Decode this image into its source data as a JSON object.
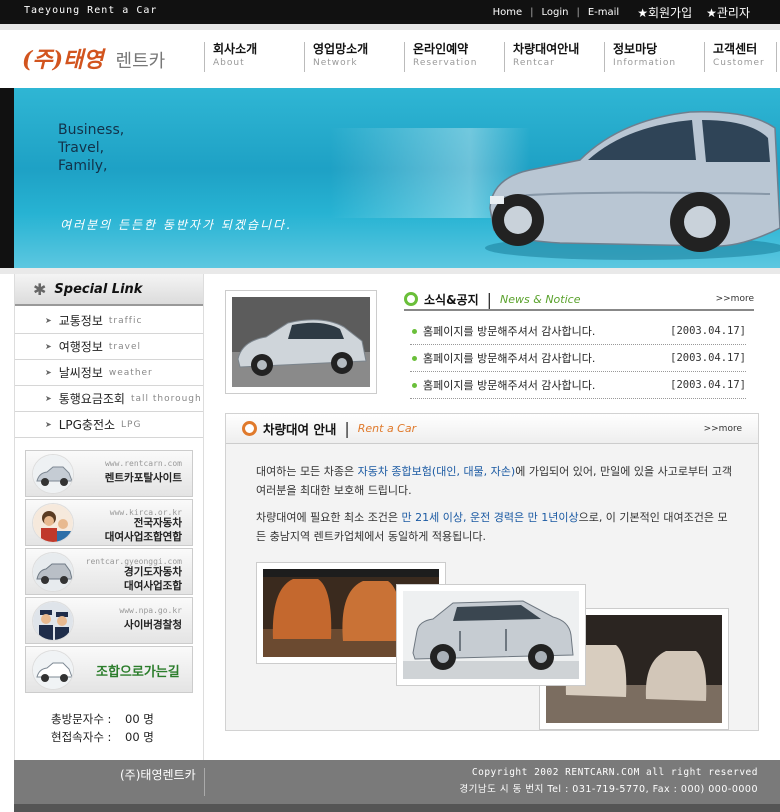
{
  "topbar": {
    "brand": "Taeyoung Rent a Car",
    "links": [
      "Home",
      "Login",
      "E-mail"
    ],
    "join": "★회원가입",
    "admin": "★관리자"
  },
  "logo": {
    "name": "(주)태영",
    "suffix": "렌트카"
  },
  "nav": [
    {
      "ko": "회사소개",
      "en": "About"
    },
    {
      "ko": "영업망소개",
      "en": "Network"
    },
    {
      "ko": "온라인예약",
      "en": "Reservation"
    },
    {
      "ko": "차량대여안내",
      "en": "Rentcar"
    },
    {
      "ko": "정보마당",
      "en": "Information"
    },
    {
      "ko": "고객센터",
      "en": "Customer"
    }
  ],
  "banner": {
    "tagline": [
      "Business,",
      "Travel,",
      "Family,"
    ],
    "slogan": "여러분의 든든한 동반자가 되겠습니다."
  },
  "special_link": {
    "title": "Special Link",
    "items": [
      {
        "ko": "교통정보",
        "en": "traffic"
      },
      {
        "ko": "여행정보",
        "en": "travel"
      },
      {
        "ko": "날씨정보",
        "en": "weather"
      },
      {
        "ko": "통행요금조회",
        "en": "tall thorough"
      },
      {
        "ko": "LPG충전소",
        "en": "LPG"
      }
    ]
  },
  "link_banners": [
    {
      "url": "www.rentcarn.com",
      "name": "렌트카포탈사이트"
    },
    {
      "url": "www.kirca.or.kr",
      "name": "전국자동차\n대여사업조합연합"
    },
    {
      "url": "rentcar.gyeonggi.com",
      "name": "경기도자동차\n대여사업조합"
    },
    {
      "url": "www.npa.go.kr",
      "name": "사이버경찰청"
    },
    {
      "name": "조합으로가는길"
    }
  ],
  "stats": {
    "total_label": "총방문자수 :",
    "total_value": "00 명",
    "current_label": "현접속자수 :",
    "current_value": "00 명"
  },
  "news": {
    "title": "소식&공지",
    "subtitle": "News & Notice",
    "more": ">>more",
    "items": [
      {
        "title": "홈페이지를 방문해주셔서 감사합니다.",
        "date": "[2003.04.17]"
      },
      {
        "title": "홈페이지를 방문해주셔서 감사합니다.",
        "date": "[2003.04.17]"
      },
      {
        "title": "홈페이지를 방문해주셔서 감사합니다.",
        "date": "[2003.04.17]"
      }
    ]
  },
  "rent": {
    "title": "차량대여 안내",
    "subtitle": "Rent a Car",
    "more": ">>more",
    "p1_a": "대여하는 모든 차종은 ",
    "p1_hl": "자동차 종합보험(대인, 대물, 자손)",
    "p1_b": "에 가입되어 있어, 만일에 있을 사고로부터 고객여러분을 최대한 보호해 드립니다.",
    "p2_a": "차량대여에 필요한 최소 조건은 ",
    "p2_hl": "만 21세 이상, 운전 경력은 만 1년이상",
    "p2_b": "으로, 이 기본적인 대여조건은 모든 충남지역 렌트카업체에서 동일하게 적용됩니다."
  },
  "footer": {
    "company": "(주)태영렌트카",
    "copyright": "Copyright 2002 RENTCARN.COM all right reserved",
    "address": "경기남도  시  동  번지   Tel : 031-719-5770, Fax : 000) 000-0000"
  },
  "colors": {
    "accent_orange": "#d2541e",
    "news_green": "#6abf3a",
    "rent_orange": "#e07a2c",
    "banner_blue": "#1ea1c5"
  }
}
